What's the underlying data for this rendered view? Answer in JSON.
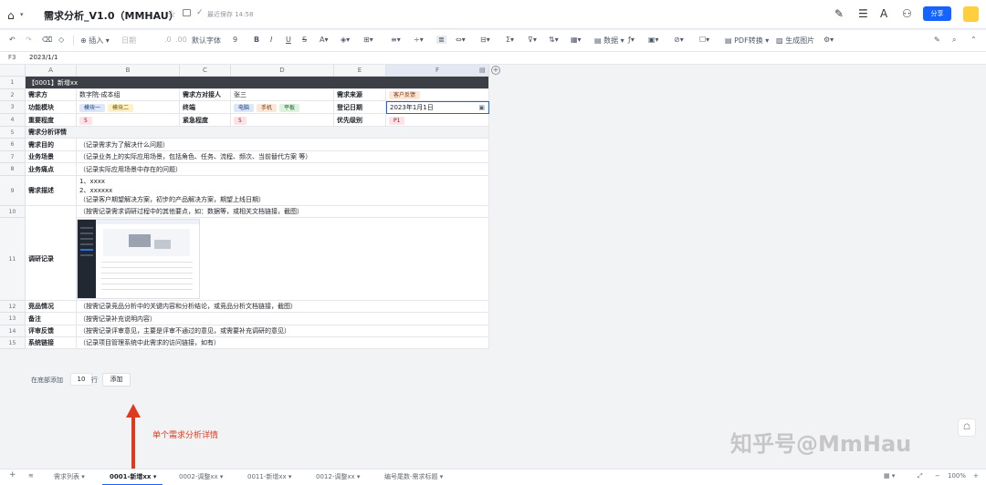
{
  "titlebar": {
    "doc_title": "需求分析_V1.0（MMHAU）",
    "saved_text": "最近保存 14:58",
    "share_label": "分享"
  },
  "toolbar": {
    "insert_label": "插入",
    "date_label": "日期",
    "default_font": "默认字体",
    "font_size": "9",
    "pdf_label": "PDF转换",
    "image_label": "生成图片",
    "data_label": "数据"
  },
  "formula": {
    "cell_ref": "F3",
    "value": "2023/1/1"
  },
  "columns": [
    "A",
    "B",
    "C",
    "D",
    "E",
    "F"
  ],
  "rows": [
    {
      "num": "1",
      "title": "【0001】新增xx"
    },
    {
      "num": "2",
      "a": "需求方",
      "b": "数字院-成本组",
      "c": "需求方对接人",
      "d": "张三",
      "e": "需求来源",
      "f_tag": "客户反馈"
    },
    {
      "num": "3",
      "a": "功能模块",
      "b_tags": [
        "模块一",
        "模块二"
      ],
      "c": "终端",
      "d_tags": [
        "电脑",
        "手机",
        "平板"
      ],
      "e": "登记日期",
      "f": "2023年1月1日"
    },
    {
      "num": "4",
      "a": "重要程度",
      "b_tag": "5",
      "c": "紧急程度",
      "d_tag": "5",
      "e": "优先级别",
      "f_tag": "P1"
    },
    {
      "num": "5",
      "a": "需求分析详情"
    },
    {
      "num": "6",
      "a": "需求目的",
      "content": "（记录需求为了解决什么问题）"
    },
    {
      "num": "7",
      "a": "业务场景",
      "content": "（记录业务上的实际应用场景，包括角色、任务、流程、频次、当前替代方案 等）"
    },
    {
      "num": "8",
      "a": "业务痛点",
      "content": "（记录实际应用场景中存在的问题）"
    },
    {
      "num": "9",
      "a": "需求描述",
      "lines": [
        "1、xxxx",
        "2、xxxxxx",
        "（记录客户期望解决方案，初步的产品解决方案，期望上线日期）"
      ]
    },
    {
      "num": "10",
      "a": "",
      "content": "（按需记录需求调研过程中的其他要点，如：数据等，或相关文档链接，截图）"
    },
    {
      "num": "11",
      "a": "调研记录"
    },
    {
      "num": "12",
      "a": "竞品情况",
      "content": "（按需记录竞品分析中的关键内容和分析结论，或竞品分析文档链接，截图）"
    },
    {
      "num": "13",
      "a": "备注",
      "content": "（按需记录补充说明内容）"
    },
    {
      "num": "14",
      "a": "评审反馈",
      "content": "（按需记录评审意见，主要是评审不通过的意见，或需要补充调研的意见）"
    },
    {
      "num": "15",
      "a": "系统链接",
      "content": "（记录项目管理系统中此需求的访问链接，如有）"
    }
  ],
  "add_rows": {
    "prefix": "在底部添加",
    "count": "10",
    "suffix": "行",
    "button": "添加"
  },
  "annotation": "单个需求分析详情",
  "watermark": "知乎号@MmHau",
  "tabs": [
    {
      "label": "需求列表"
    },
    {
      "label": "0001-新增xx",
      "active": true
    },
    {
      "label": "0002-调整xx"
    },
    {
      "label": "0011-新增xx"
    },
    {
      "label": "0012-调整xx"
    },
    {
      "label": "编号尾数-需求标题"
    }
  ],
  "zoom": "100%",
  "colors": {
    "accent": "#1664ff",
    "annotation": "#e03a1e",
    "title_row": "#3c3f46"
  }
}
